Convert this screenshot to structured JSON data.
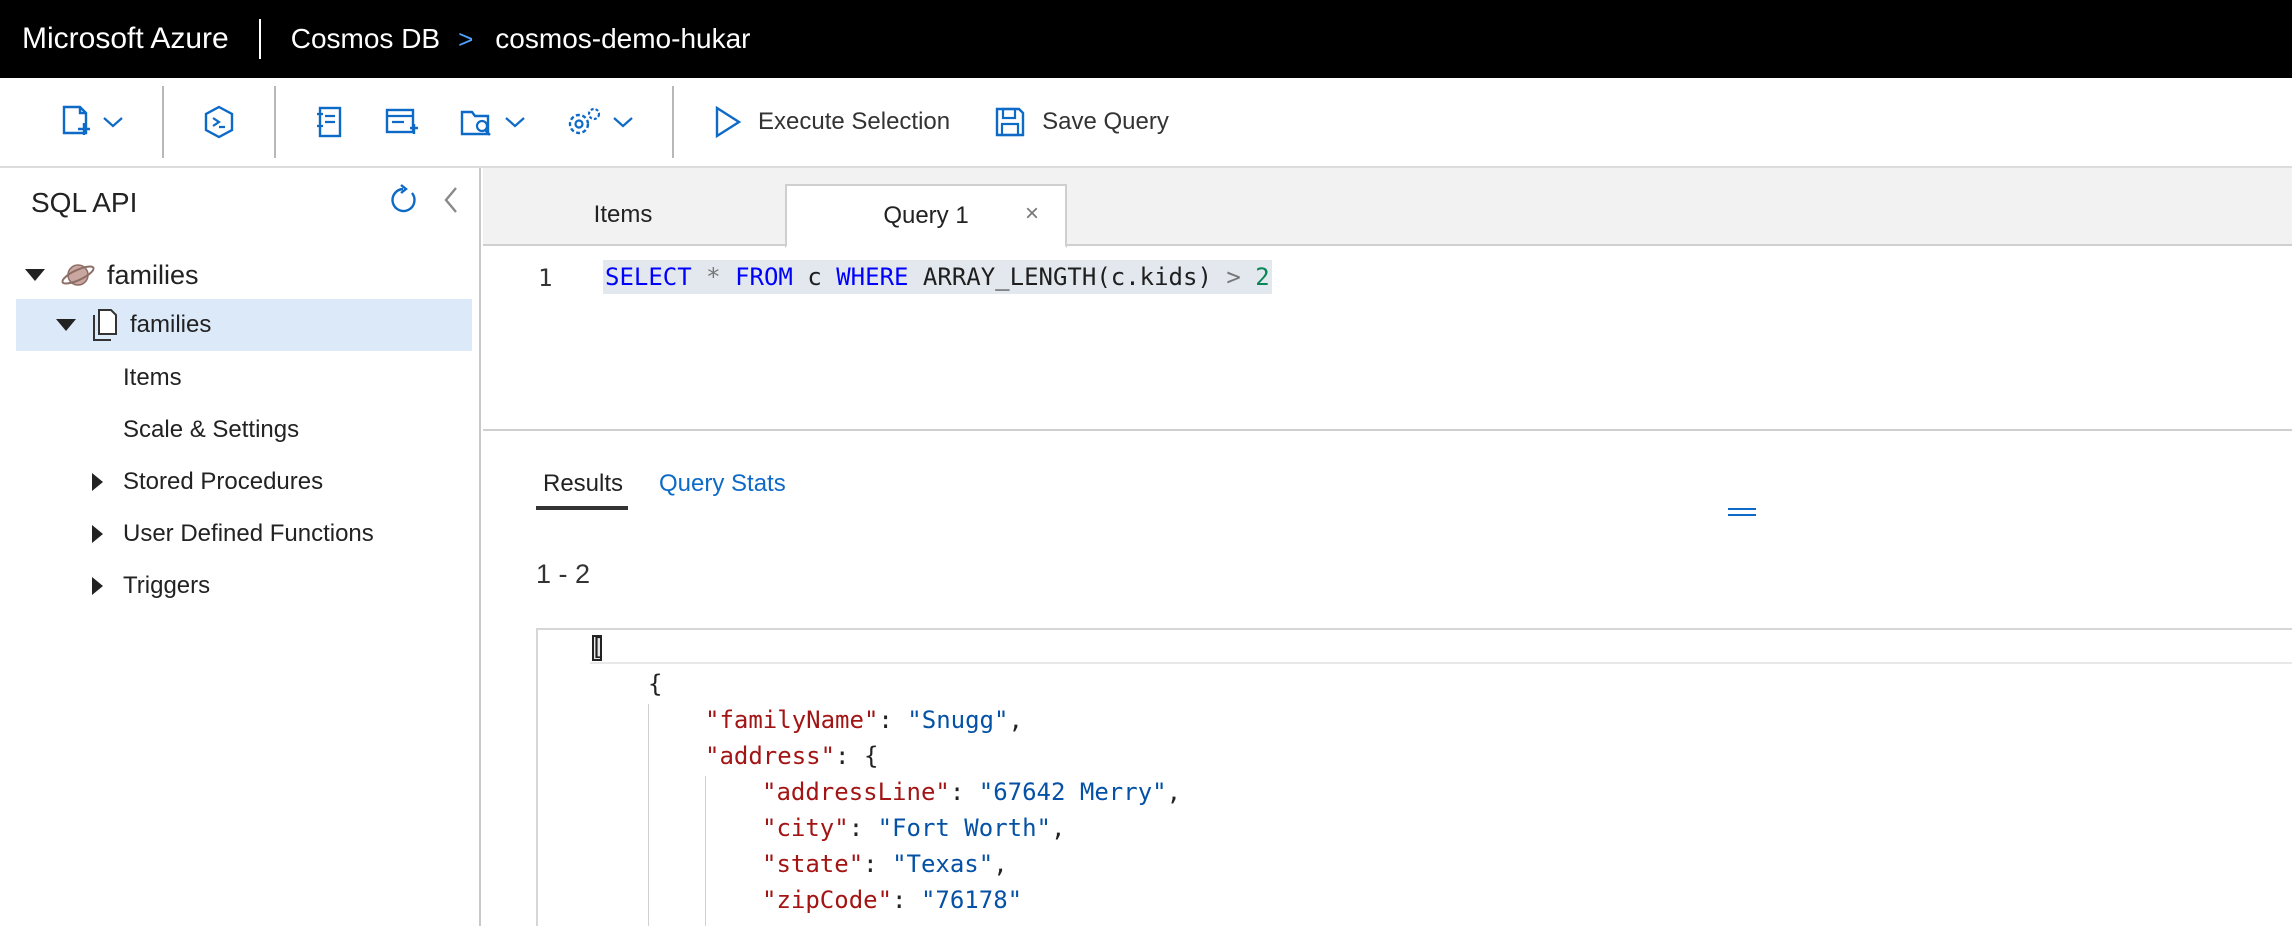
{
  "topbar": {
    "brand": "Microsoft Azure",
    "service": "Cosmos DB",
    "separator": ">",
    "account": "cosmos-demo-hukar"
  },
  "commandbar": {
    "icons": [
      "new-container-icon",
      "dropdown-chevron-icon",
      "cosmos-shell-icon",
      "new-notebook-icon",
      "new-sql-query-icon",
      "open-folder-icon",
      "settings-gear-icon"
    ],
    "execute_label": "Execute Selection",
    "save_label": "Save Query"
  },
  "sidebar": {
    "title": "SQL API",
    "tree": {
      "database": "families",
      "container": "families",
      "items": [
        {
          "label": "Items"
        },
        {
          "label": "Scale & Settings"
        },
        {
          "label": "Stored Procedures"
        },
        {
          "label": "User Defined Functions"
        },
        {
          "label": "Triggers"
        }
      ]
    }
  },
  "tabs": [
    {
      "label": "Items"
    },
    {
      "label": "Query 1",
      "close": "×"
    }
  ],
  "editor": {
    "line_number": "1",
    "tokens": {
      "select": "SELECT",
      "star": "*",
      "from": "FROM",
      "alias": "c",
      "where": "WHERE",
      "func": "ARRAY_LENGTH(c.kids)",
      "gt": ">",
      "value": "2"
    }
  },
  "results": {
    "tab_results": "Results",
    "tab_stats": "Query Stats",
    "range": "1 - 2",
    "json": {
      "open_bracket": "[",
      "open_brace": "{",
      "familyName_key": "\"familyName\"",
      "familyName_val": "\"Snugg\"",
      "address_key": "\"address\"",
      "addressLine_key": "\"addressLine\"",
      "addressLine_val": "\"67642 Merry\"",
      "city_key": "\"city\"",
      "city_val": "\"Fort Worth\"",
      "state_key": "\"state\"",
      "state_val": "\"Texas\"",
      "zipCode_key": "\"zipCode\"",
      "zipCode_val": "\"76178\""
    }
  },
  "colors": {
    "topbar_bg": "#000000",
    "accent": "#0e6ac7",
    "selected_row": "#dbe9f8",
    "sql_keyword": "#0000ff",
    "json_key": "#a31515",
    "json_string": "#0451a5"
  }
}
